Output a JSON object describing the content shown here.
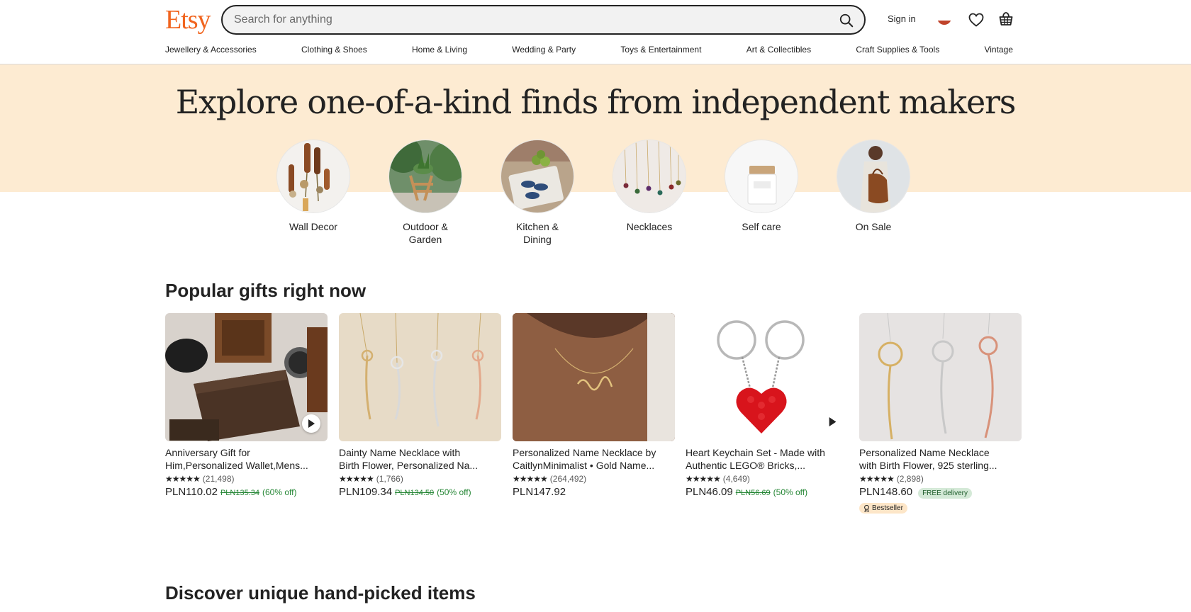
{
  "header": {
    "logo": "Etsy",
    "search_placeholder": "Search for anything",
    "sign_in": "Sign in",
    "brand_color": "#F1641E",
    "icons": [
      "search-icon",
      "flag-icon",
      "heart-icon",
      "basket-icon"
    ]
  },
  "nav": {
    "categories": [
      "Jewellery & Accessories",
      "Clothing & Shoes",
      "Home & Living",
      "Wedding & Party",
      "Toys & Entertainment",
      "Art & Collectibles",
      "Craft Supplies & Tools",
      "Vintage"
    ]
  },
  "hero": {
    "title": "Explore one-of-a-kind finds from independent makers",
    "background": "#FDEBD2",
    "circles": [
      {
        "line1": "Wall Decor",
        "line2": ""
      },
      {
        "line1": "Outdoor &",
        "line2": "Garden"
      },
      {
        "line1": "Kitchen &",
        "line2": "Dining"
      },
      {
        "line1": "Necklaces",
        "line2": ""
      },
      {
        "line1": "Self care",
        "line2": ""
      },
      {
        "line1": "On Sale",
        "line2": ""
      }
    ]
  },
  "popular": {
    "title": "Popular gifts right now",
    "items": [
      {
        "line1": "Anniversary Gift for",
        "line2": "Him,Personalized Wallet,Mens...",
        "stars": "★★★★★",
        "reviews": "(21,498)",
        "price": "PLN110.02",
        "old_price": "PLN135.34",
        "discount": "(60% off)"
      },
      {
        "line1": "Dainty Name Necklace with",
        "line2": "Birth Flower, Personalized Na...",
        "stars": "★★★★★",
        "reviews": "(1,766)",
        "price": "PLN109.34",
        "old_price": "PLN134.50",
        "discount": "(50% off)"
      },
      {
        "line1": "Personalized Name Necklace by",
        "line2": "CaitlynMinimalist • Gold Name...",
        "stars": "★★★★★",
        "reviews": "(264,492)",
        "price": "PLN147.92",
        "old_price": "",
        "discount": ""
      },
      {
        "line1": "Heart Keychain Set - Made with",
        "line2": "Authentic LEGO® Bricks,...",
        "stars": "★★★★★",
        "reviews": "(4,649)",
        "price": "PLN46.09",
        "old_price": "PLN56.69",
        "discount": "(50% off)"
      },
      {
        "line1": "Personalized Name Necklace",
        "line2": "with Birth Flower, 925 sterling...",
        "stars": "★★★★★",
        "reviews": "(2,898)",
        "price": "PLN148.60",
        "old_price": "",
        "discount": "",
        "free": "FREE delivery",
        "badge": "Bestseller"
      }
    ]
  },
  "discover": {
    "title": "Discover unique hand-picked items"
  }
}
